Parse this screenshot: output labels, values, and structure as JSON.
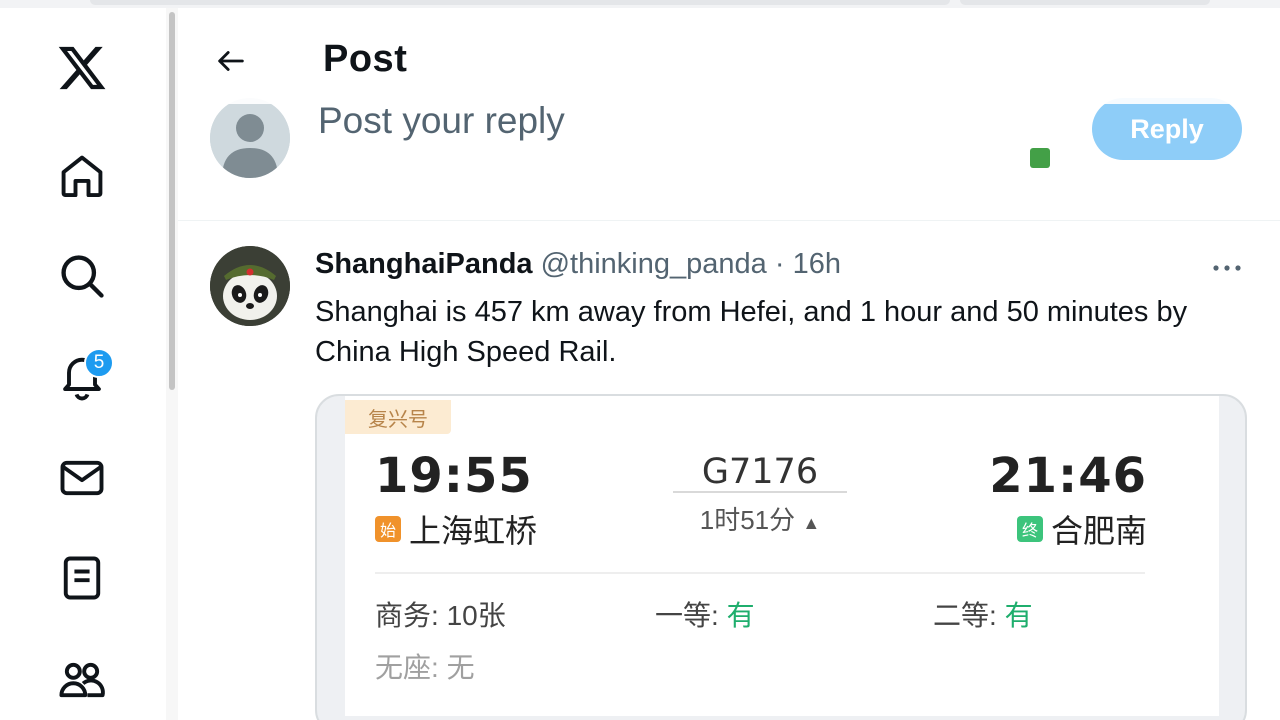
{
  "sidebar": {
    "items": [
      {
        "name": "x-logo",
        "label": "X"
      },
      {
        "name": "home",
        "label": "Home"
      },
      {
        "name": "explore",
        "label": "Explore"
      },
      {
        "name": "notifications",
        "label": "Notifications"
      },
      {
        "name": "messages",
        "label": "Messages"
      },
      {
        "name": "lists",
        "label": "Lists"
      },
      {
        "name": "communities",
        "label": "Communities"
      }
    ],
    "notification_count": "5"
  },
  "header": {
    "title": "Post"
  },
  "composer": {
    "placeholder": "Post your reply",
    "reply_label": "Reply"
  },
  "tweet": {
    "author_name": "ShanghaiPanda",
    "author_handle": "@thinking_panda",
    "separator": "·",
    "time": "16h",
    "text": "Shanghai is 457 km away from Hefei, and 1 hour and 50 minutes by China High Speed Rail."
  },
  "ticket": {
    "tag": "复兴号",
    "departure_time": "19:55",
    "arrival_time": "21:46",
    "train_number": "G7176",
    "duration": "1时51分",
    "departure_icon": "始",
    "departure_station": "上海虹桥",
    "arrival_icon": "终",
    "arrival_station": "合肥南",
    "seats": {
      "business_label": "商务:",
      "business_value": "10张",
      "first_label": "一等:",
      "first_value": "有",
      "second_label": "二等:",
      "second_value": "有",
      "standing_label": "无座:",
      "standing_value": "无"
    }
  },
  "colors": {
    "accent": "#1d9bf0",
    "reply_button": "#8ecdf8",
    "available": "#1fae6d",
    "departure_icon": "#f0922b",
    "arrival_icon": "#3cc47c"
  }
}
